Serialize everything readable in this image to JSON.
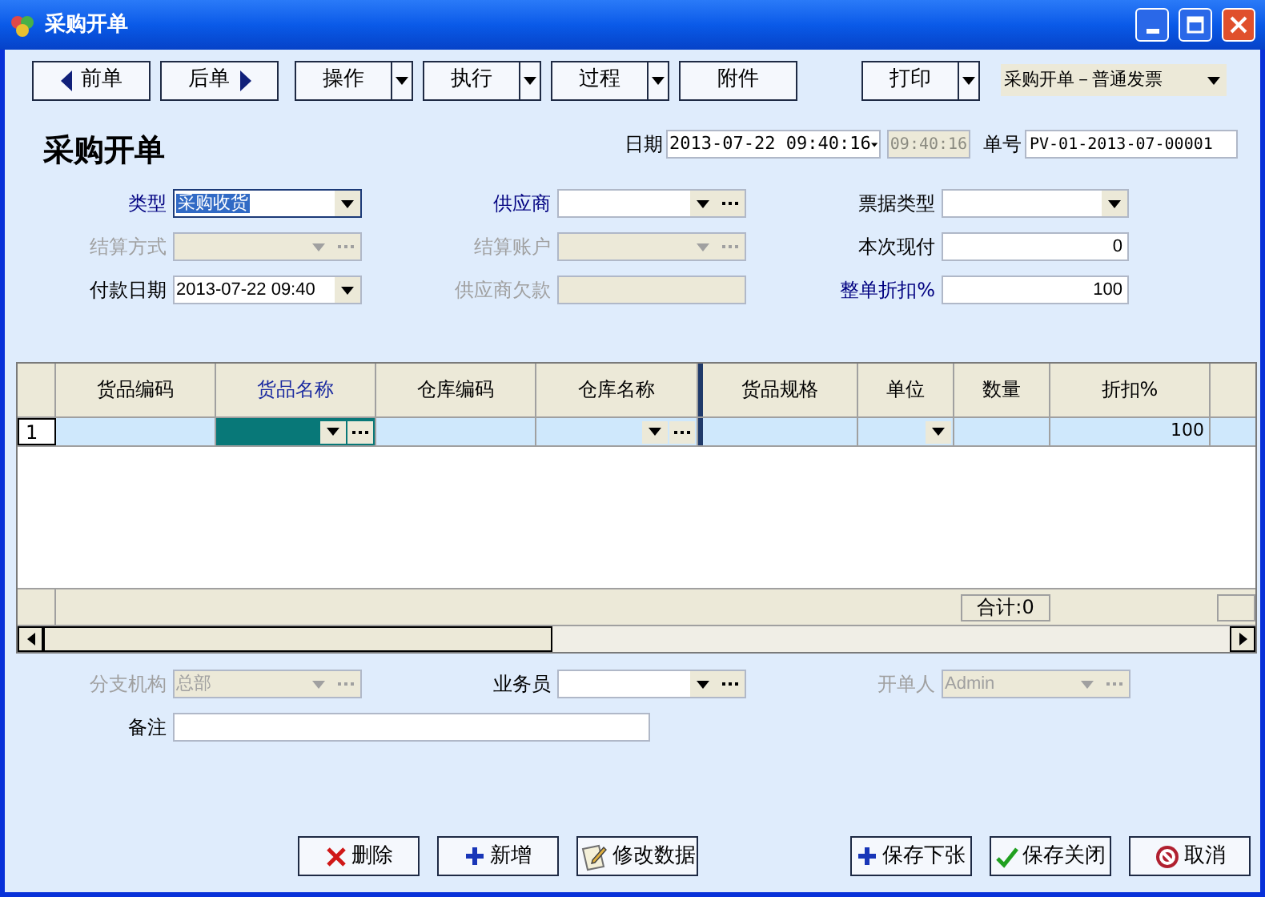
{
  "window": {
    "title": "采购开单"
  },
  "toolbar": [
    {
      "label": "前单",
      "kind": "prev"
    },
    {
      "label": "后单",
      "kind": "next"
    },
    {
      "label": "操作",
      "kind": "menu"
    },
    {
      "label": "执行",
      "kind": "menu"
    },
    {
      "label": "过程",
      "kind": "menu"
    },
    {
      "label": "附件",
      "kind": "plain"
    },
    {
      "label": "打印",
      "kind": "menu"
    }
  ],
  "print_template": {
    "value": "采购开单－普通发票"
  },
  "heading": "采购开单",
  "date": {
    "label": "日期",
    "value": "2013-07-22 09:40:16",
    "time": "09:40:16"
  },
  "doc_number": {
    "label": "单号",
    "value": "PV-01-2013-07-00001"
  },
  "form_rows": [
    [
      {
        "label": "类型",
        "value": "采购收货",
        "kind": "combo",
        "required": true,
        "disabled": false,
        "selected": true
      },
      {
        "label": "供应商",
        "kind": "lookup",
        "required": true,
        "disabled": false,
        "selected": false
      },
      {
        "label": "票据类型",
        "kind": "combo",
        "required": false,
        "disabled": false,
        "selected": false
      }
    ],
    [
      {
        "label": "结算方式",
        "kind": "lookup",
        "disabled": true,
        "selected": false
      },
      {
        "label": "结算账户",
        "kind": "lookup",
        "disabled": true,
        "selected": false
      },
      {
        "label": "本次现付",
        "value": "0",
        "kind": "number",
        "required": false,
        "disabled": false,
        "selected": false
      }
    ],
    [
      {
        "label": "付款日期",
        "value": "2013-07-22 09:40",
        "kind": "combo",
        "required": false,
        "disabled": false,
        "selected": false
      },
      {
        "label": "供应商欠款",
        "kind": "text",
        "disabled": true,
        "selected": false
      },
      {
        "label": "整单折扣%",
        "value": "100",
        "kind": "number",
        "required": true,
        "disabled": false,
        "selected": false
      }
    ]
  ],
  "grid": {
    "columns": [
      {
        "label": "货品编码",
        "selected": false
      },
      {
        "label": "货品名称",
        "selected": true
      },
      {
        "label": "仓库编码",
        "selected": false
      },
      {
        "label": "仓库名称",
        "selected": false
      },
      {
        "label": "货品规格",
        "selected": false
      },
      {
        "label": "单位",
        "selected": false
      },
      {
        "label": "数量",
        "selected": false
      },
      {
        "label": "折扣%",
        "selected": false
      }
    ],
    "rows": [
      {
        "number": "1",
        "cells": [
          {
            "kind": "text",
            "selected": false
          },
          {
            "kind": "lookup",
            "selected": true
          },
          {
            "kind": "text",
            "selected": false
          },
          {
            "kind": "lookup",
            "selected": false
          },
          {
            "kind": "text",
            "selected": false
          },
          {
            "kind": "combo",
            "selected": false
          },
          {
            "kind": "text",
            "selected": false
          },
          {
            "kind": "number",
            "value": "100",
            "selected": false
          }
        ]
      }
    ],
    "total": "合计:0"
  },
  "bottom_fields": [
    {
      "label": "分支机构",
      "value": "总部",
      "kind": "lookup",
      "disabled": true,
      "selected": false
    },
    {
      "label": "业务员",
      "kind": "lookup",
      "required": false,
      "disabled": false,
      "selected": false
    },
    {
      "label": "开单人",
      "value": "Admin",
      "kind": "lookup",
      "disabled": true,
      "selected": false
    }
  ],
  "notes": {
    "label": "备注"
  },
  "actions": [
    {
      "label": "删除",
      "kind": "delete"
    },
    {
      "label": "新增",
      "kind": "add"
    },
    {
      "label": "修改数据",
      "kind": "edit"
    },
    {
      "label": "保存下张",
      "kind": "add"
    },
    {
      "label": "保存关闭",
      "kind": "check"
    },
    {
      "label": "取消",
      "kind": "cancel"
    }
  ]
}
